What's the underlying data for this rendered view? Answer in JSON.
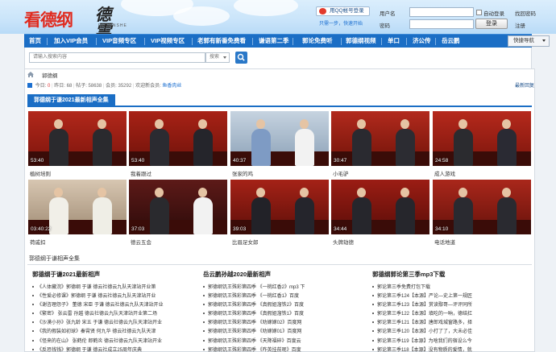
{
  "header": {
    "logo_main": "看德纲",
    "logo_sub": "德雲社",
    "logo_eng": "DEYUNSHE",
    "qq_login": "用QQ帐号登录",
    "qq_sub": "只需一步，快速开始",
    "username_label": "用户名",
    "password_label": "密码",
    "auto_login": "自动登录",
    "forgot": "找回密码",
    "register": "注册",
    "login_button": "登录"
  },
  "nav": {
    "items": [
      "首页",
      "加入VIP会员",
      "VIP音频专区",
      "VIP视频专区",
      "老郭有新番免费看",
      "谦语第二季",
      "郭论免费听",
      "郭德纲视频",
      "单口",
      "岳云鹏"
    ],
    "extra": "济公传",
    "quick_nav": "快捷导航"
  },
  "search": {
    "placeholder": "请输入搜索内容",
    "select": "搜索"
  },
  "breadcrumb": "郭德纲",
  "stats": {
    "today_label": "今日: ",
    "today": "0",
    "yesterday_label": "昨日: ",
    "yesterday": "68",
    "posts_label": "帖子: ",
    "posts": "58638",
    "members_label": "会员: ",
    "members": "35292",
    "new_member_label": "欢迎新会员: ",
    "new_member": "鱼香肉丝"
  },
  "latest_reply": "最新回复",
  "section_title": "郭德纲于谦2021最新相声全集",
  "videos": [
    {
      "duration": "53:40",
      "caption": "植树培则"
    },
    {
      "duration": "53:40",
      "caption": "我着跟过"
    },
    {
      "duration": "40:37",
      "caption": "张家的鸡"
    },
    {
      "duration": "30:47",
      "caption": "小毛驴"
    },
    {
      "duration": "24:58",
      "caption": "成人游戏"
    },
    {
      "duration": "03:40:22",
      "caption": "荷戚扣"
    },
    {
      "duration": "37:03",
      "caption": "德云五会"
    },
    {
      "duration": "39:03",
      "caption": "比眉足女郎"
    },
    {
      "duration": "34:44",
      "caption": "头牌劫德"
    },
    {
      "duration": "34:10",
      "caption": "电话地道"
    }
  ],
  "sub_section": "郭德纲于谦相声全集",
  "columns": [
    {
      "title": "郭德纲于谦2021最新相声",
      "items": [
        "《人体藏浣》郭德纲 于谦 德云社德云九队天津站开业第",
        "《性爱必修课》郭德纲 于谦 德云社德云九队天津站开业",
        "《谢咨理怨子》 董德 宋臣 于谦 德云社德云九队天津站开业",
        "《繁密》 张云雷 孙越 德云社德云九队天津站开业第二场",
        "《沙漠小孙》张九龄 宋五 于谦 德云社德云九队天津站开业",
        "《我的假装如初球》秦霄贤 何九华 德云社德云九队天津",
        "《怪来的在山》 张鹤伦 郎鹤炎 德云社德云九队天津站开业",
        "《反恐钱钱》郭德纲 于谦 德云社成立25周年庆典"
      ]
    },
    {
      "title": "岳云鹏孙越2020最新相声",
      "items": [
        "郭德纲饥王殊彩第四季 《一桃红香2》mp3 下",
        "郭德纲饥王殊彩第四季 《一桃红香1》百度",
        "郭德纲饥王殊彩第四季 《真假姐溜铁2》百度",
        "郭德纲饥王殊彩第四季 《真假姐溜铁1》百度",
        "郭德纲饥王殊彩第四季 《劝嫁嫁02》百度网",
        "郭德纲饥王殊彩第四季 《劝嫁嫁01》百度网",
        "郭德纲饥王殊彩第四季 《天降福碎》百度云",
        "郭德纲饥王殊彩第四季 《咋英挂前呢》百度"
      ]
    },
    {
      "title": "郭德纲郭论第三季mp3下载",
      "items": [
        "郭论第三季免费打包下载",
        "郭论第三季124【本源】严论—史上第一规匠",
        "郭论第三季123【本源】赏读鄢哥—评评同所",
        "郭论第三季122【本源】填吃的一晌，德结扛",
        "郭论第三季121【本源】唐郎戏城窗路多，择",
        "郭论第三季120【本源】小打了了，大未必佳",
        "郭论第三季119【本源】为啥我们的宿设么今",
        "郭论第三季118【本源】没有物质的爱情，就"
      ]
    }
  ]
}
